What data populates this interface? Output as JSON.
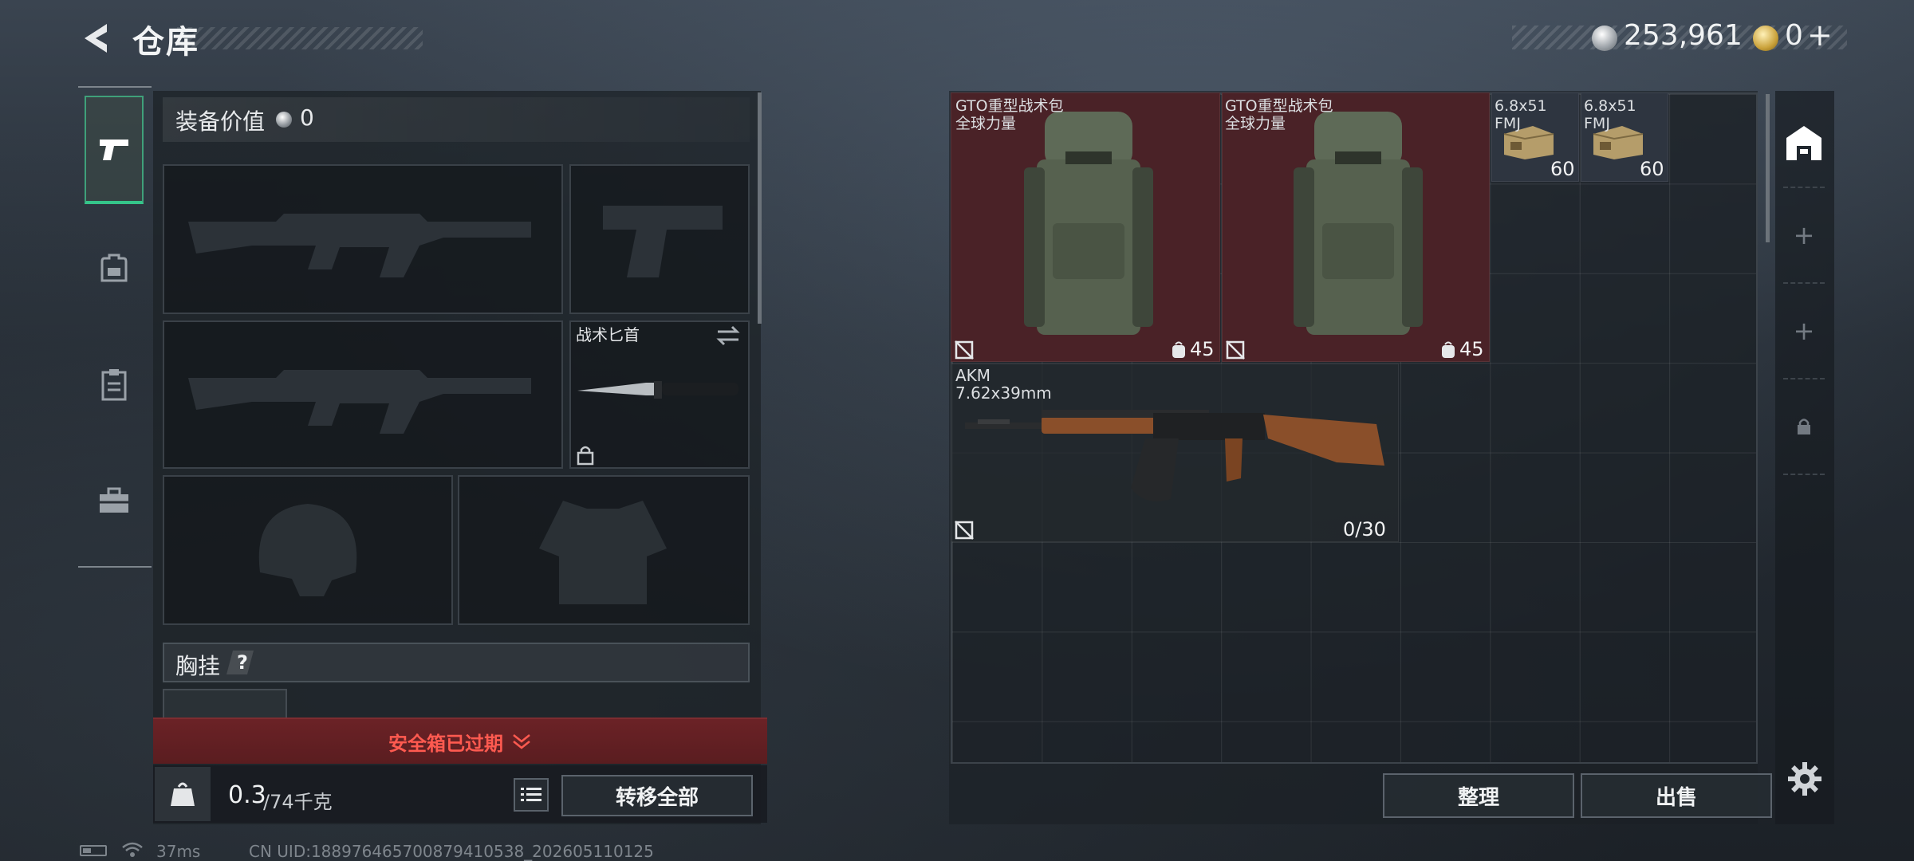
{
  "header": {
    "title": "仓库",
    "silver_currency": "253,961",
    "gold_currency": "0",
    "gold_plus": "+"
  },
  "tabs": [
    {
      "id": "weapons",
      "icon": "pistol-icon",
      "active": true
    },
    {
      "id": "backpack",
      "icon": "backpack-icon"
    },
    {
      "id": "chest-rig",
      "icon": "clipboard-vest-icon"
    },
    {
      "id": "safe-case",
      "icon": "toolbox-icon"
    }
  ],
  "equipment": {
    "value_label": "装备价值",
    "value": "0",
    "melee_name": "战术匕首",
    "chest_rig_label": "胸挂",
    "help_symbol": "?",
    "safe_case_expired": "安全箱已过期",
    "weight_current": "0.3",
    "weight_max": "/74千克",
    "weight_icon_text": "KG",
    "transfer_all": "转移全部"
  },
  "stash": {
    "items": [
      {
        "name": "GTO重型战术包",
        "sub": "全球力量",
        "capacity": "45"
      },
      {
        "name": "GTO重型战术包",
        "sub": "全球力量",
        "capacity": "45"
      },
      {
        "name": "6.8x51",
        "sub": "FMJ",
        "count": "60"
      },
      {
        "name": "6.8x51",
        "sub": "FMJ",
        "count": "60"
      },
      {
        "name": "AKM",
        "sub": "7.62x39mm",
        "ammo": "0/30"
      }
    ],
    "sort_label": "整理",
    "sell_label": "出售"
  },
  "side": {
    "plus": "+"
  },
  "status": {
    "ping": "37ms",
    "uid": "CN UID:1889764657008794105​38_202605110125"
  },
  "colors": {
    "accent_green": "#35c58a",
    "warning_red": "#ff5a50",
    "item_red_bg": "#4a2227"
  }
}
